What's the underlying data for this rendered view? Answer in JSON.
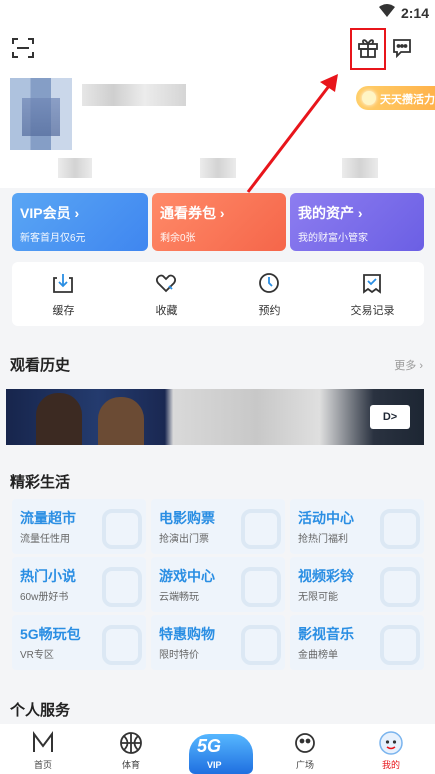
{
  "status": {
    "time": "2:14"
  },
  "header": {
    "signin_label": "天天攒活力"
  },
  "cards": [
    {
      "title": "VIP会员",
      "sub": "新客首月仅6元"
    },
    {
      "title": "通看券包",
      "sub": "剩余0张"
    },
    {
      "title": "我的资产",
      "sub": "我的财富小管家"
    }
  ],
  "quick": [
    {
      "label": "缓存",
      "icon": "download-icon"
    },
    {
      "label": "收藏",
      "icon": "heart-icon"
    },
    {
      "label": "预约",
      "icon": "clock-icon"
    },
    {
      "label": "交易记录",
      "icon": "receipt-icon"
    }
  ],
  "history": {
    "title": "观看历史",
    "more": "更多",
    "banner_tag": "D>"
  },
  "life": {
    "title": "精彩生活",
    "items": [
      {
        "title": "流量超市",
        "sub": "流量任性用"
      },
      {
        "title": "电影购票",
        "sub": "抢演出门票"
      },
      {
        "title": "活动中心",
        "sub": "抢热门福利"
      },
      {
        "title": "热门小说",
        "sub": "60w册好书"
      },
      {
        "title": "游戏中心",
        "sub": "云端畅玩"
      },
      {
        "title": "视频彩铃",
        "sub": "无限可能"
      },
      {
        "title": "5G畅玩包",
        "sub": "VR专区"
      },
      {
        "title": "特惠购物",
        "sub": "限时特价"
      },
      {
        "title": "影视音乐",
        "sub": "金曲榜单"
      }
    ]
  },
  "personal": {
    "title": "个人服务"
  },
  "nav": {
    "items": [
      {
        "label": "首页"
      },
      {
        "label": "体育"
      },
      {
        "label": "广场"
      },
      {
        "label": "我的"
      }
    ],
    "vip_top": "5G",
    "vip_label": "VIP"
  },
  "colors": {
    "accent_red": "#e8151b",
    "link_blue": "#2a8ee3"
  }
}
